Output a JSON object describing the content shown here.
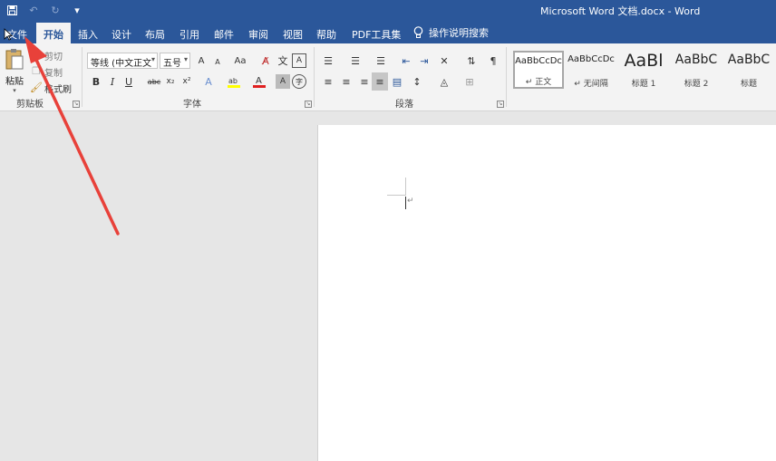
{
  "window": {
    "title": "Microsoft Word 文档.docx  -  Word",
    "qat": {
      "save_icon": "save-icon",
      "undo_icon": "undo-icon",
      "redo_icon": "redo-icon",
      "customize_icon": "customize-qat-icon"
    }
  },
  "tabs": [
    {
      "label": "文件"
    },
    {
      "label": "开始"
    },
    {
      "label": "插入"
    },
    {
      "label": "设计"
    },
    {
      "label": "布局"
    },
    {
      "label": "引用"
    },
    {
      "label": "邮件"
    },
    {
      "label": "审阅"
    },
    {
      "label": "视图"
    },
    {
      "label": "帮助"
    },
    {
      "label": "PDF工具集"
    }
  ],
  "tell_me": {
    "label": "操作说明搜索",
    "icon": "lightbulb-icon"
  },
  "clipboard": {
    "label": "剪贴板",
    "paste": "粘贴",
    "cut": "剪切",
    "copy": "复制",
    "format_painter": "格式刷"
  },
  "font": {
    "label": "字体",
    "name": "等线 (中文正文",
    "size": "五号",
    "bold": "B",
    "italic": "I",
    "underline": "U",
    "strike": "abc",
    "subscript": "x₂",
    "superscript": "x²",
    "grow": "A",
    "shrink": "A",
    "change_case": "Aa",
    "font_color": "A",
    "highlight_color": "ab"
  },
  "paragraph": {
    "label": "段落"
  },
  "styles": {
    "items": [
      {
        "sample": "AaBbCcDc",
        "name": "↵ 正文"
      },
      {
        "sample": "AaBbCcDc",
        "name": "↵ 无间隔"
      },
      {
        "sample": "AaBl",
        "name": "标题 1"
      },
      {
        "sample": "AaBbC",
        "name": "标题 2"
      },
      {
        "sample": "AaBbC",
        "name": "标题"
      }
    ]
  },
  "colors": {
    "accent": "#2b579a",
    "annotation_arrow": "#e8413a",
    "font_color_bar": "#e02020",
    "highlight_bar": "#ffff00"
  }
}
